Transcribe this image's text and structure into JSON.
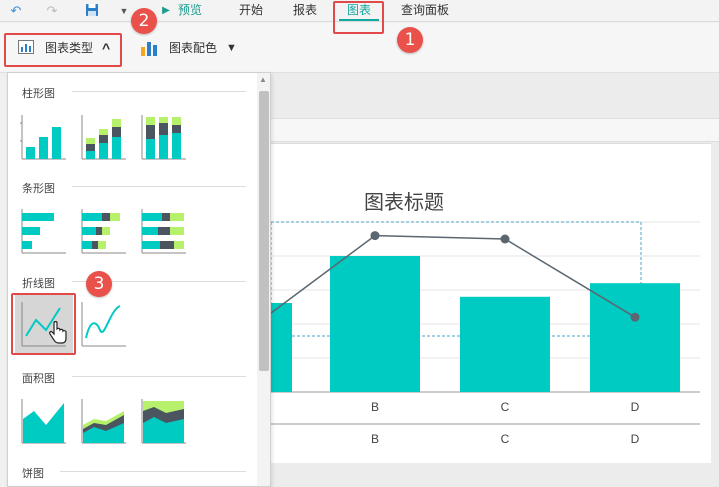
{
  "menubar": {
    "preview": "预览",
    "tabs": [
      {
        "label": "开始"
      },
      {
        "label": "报表"
      },
      {
        "label": "图表"
      },
      {
        "label": "查询面板"
      }
    ]
  },
  "ribbon": {
    "chart_type": "图表类型",
    "chart_color": "图表配色"
  },
  "badges": [
    "1",
    "2",
    "3"
  ],
  "panel": {
    "sections": [
      {
        "title": "柱形图"
      },
      {
        "title": "条形图"
      },
      {
        "title": "折线图"
      },
      {
        "title": "面积图"
      },
      {
        "title": "饼图"
      }
    ]
  },
  "colors": {
    "accent": "#00cbc2",
    "green": "#b7f06a",
    "gray": "#4a5560",
    "badge": "#e9514a"
  },
  "chart_data": {
    "type": "bar",
    "title": "图表标题",
    "categories": [
      "B",
      "C",
      "D"
    ],
    "series": [
      {
        "type": "bar",
        "values": [
          40,
          28,
          32
        ]
      },
      {
        "type": "line",
        "values": [
          46,
          45,
          22
        ]
      }
    ],
    "ylim": [
      0,
      50
    ],
    "axis_rows": [
      [
        "B",
        "C",
        "D"
      ],
      [
        "B",
        "C",
        "D"
      ]
    ]
  }
}
